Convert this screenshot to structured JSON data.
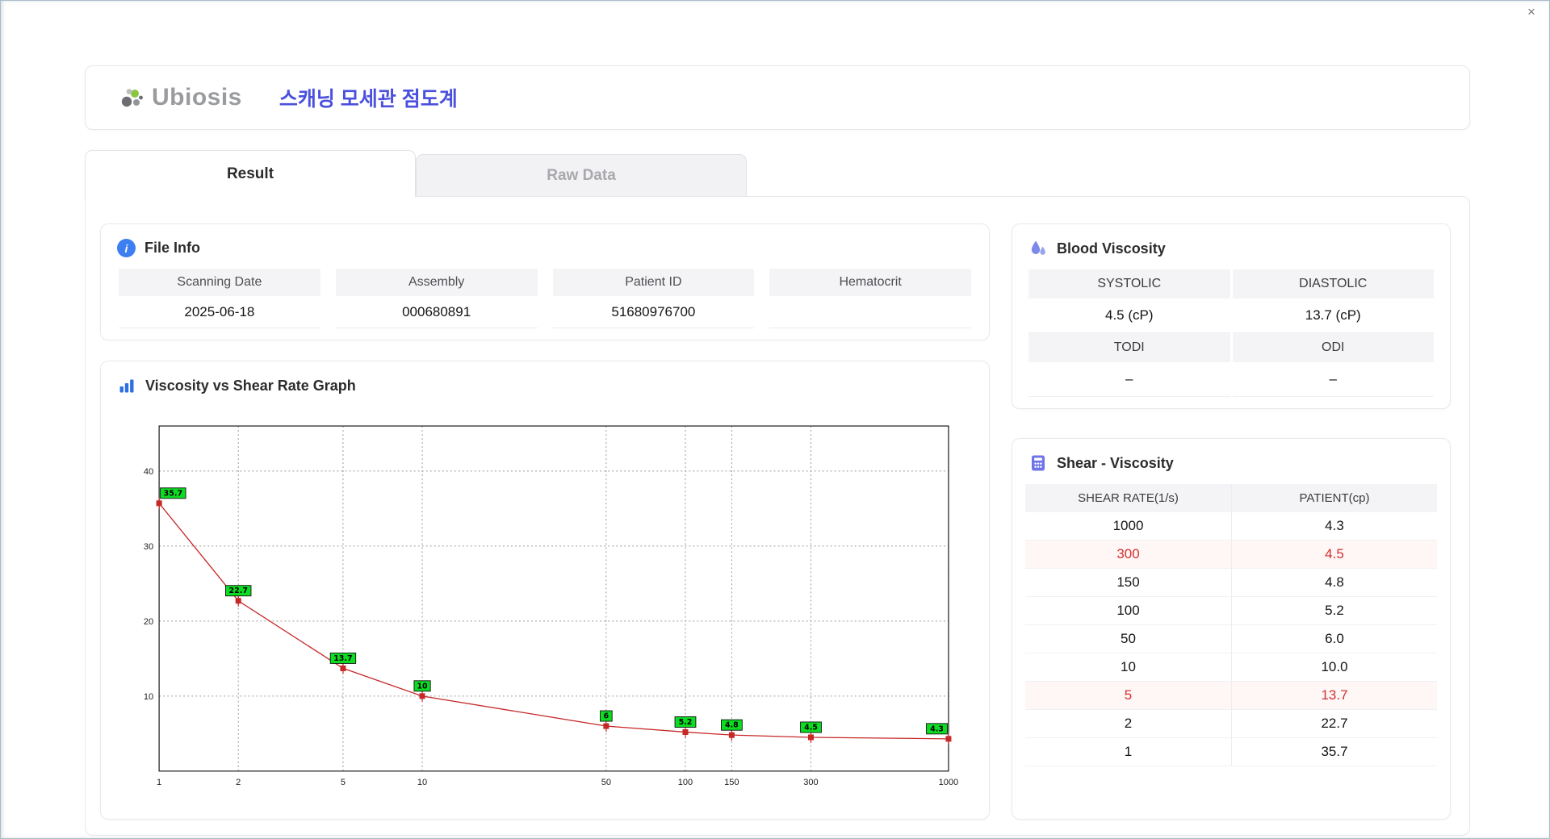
{
  "window": {
    "close_glyph": "×"
  },
  "icons": {
    "info_glyph": "i"
  },
  "header": {
    "logo_text": "Ubiosis",
    "title": "스캐닝 모세관 점도계"
  },
  "tabs": [
    {
      "label": "Result",
      "active": true
    },
    {
      "label": "Raw Data",
      "active": false
    }
  ],
  "file_info": {
    "title": "File Info",
    "fields": [
      {
        "label": "Scanning Date",
        "value": "2025-06-18"
      },
      {
        "label": "Assembly",
        "value": "000680891"
      },
      {
        "label": "Patient ID",
        "value": "51680976700"
      },
      {
        "label": "Hematocrit",
        "value": ""
      }
    ]
  },
  "blood_viscosity": {
    "title": "Blood Viscosity",
    "cells": [
      {
        "label": "SYSTOLIC",
        "value": "4.5 (cP)"
      },
      {
        "label": "DIASTOLIC",
        "value": "13.7 (cP)"
      },
      {
        "label": "TODI",
        "value": "–"
      },
      {
        "label": "ODI",
        "value": "–"
      }
    ]
  },
  "graph": {
    "title": "Viscosity vs Shear Rate Graph"
  },
  "chart_data": {
    "type": "line",
    "title": "Viscosity vs Shear Rate Graph",
    "xlabel": "",
    "ylabel": "",
    "x_scale": "log",
    "x": [
      1,
      2,
      5,
      10,
      50,
      100,
      150,
      300,
      1000
    ],
    "values": [
      35.7,
      22.7,
      13.7,
      10,
      6,
      5.2,
      4.8,
      4.5,
      4.3
    ],
    "point_labels": [
      "35.7",
      "22.7",
      "13.7",
      "10",
      "6",
      "5.2",
      "4.8",
      "4.5",
      "4.3"
    ],
    "x_ticks": [
      1,
      2,
      5,
      10,
      50,
      100,
      150,
      300,
      1000
    ],
    "y_ticks": [
      10,
      20,
      30,
      40
    ],
    "xlim": [
      1,
      1000
    ],
    "ylim": [
      0,
      46
    ],
    "grid": true,
    "legend": false,
    "line_color": "#c62828",
    "marker_color": "#c62828",
    "label_bg_color": "#0ddd22",
    "label_border_color": "#111111"
  },
  "shear_table": {
    "title": "Shear - Viscosity",
    "columns": [
      "SHEAR RATE(1/s)",
      "PATIENT(cp)"
    ],
    "rows": [
      {
        "shear": "1000",
        "patient": "4.3",
        "highlight": false
      },
      {
        "shear": "300",
        "patient": "4.5",
        "highlight": true
      },
      {
        "shear": "150",
        "patient": "4.8",
        "highlight": false
      },
      {
        "shear": "100",
        "patient": "5.2",
        "highlight": false
      },
      {
        "shear": "50",
        "patient": "6.0",
        "highlight": false
      },
      {
        "shear": "10",
        "patient": "10.0",
        "highlight": false
      },
      {
        "shear": "5",
        "patient": "13.7",
        "highlight": true
      },
      {
        "shear": "2",
        "patient": "22.7",
        "highlight": false
      },
      {
        "shear": "1",
        "patient": "35.7",
        "highlight": false
      }
    ]
  }
}
